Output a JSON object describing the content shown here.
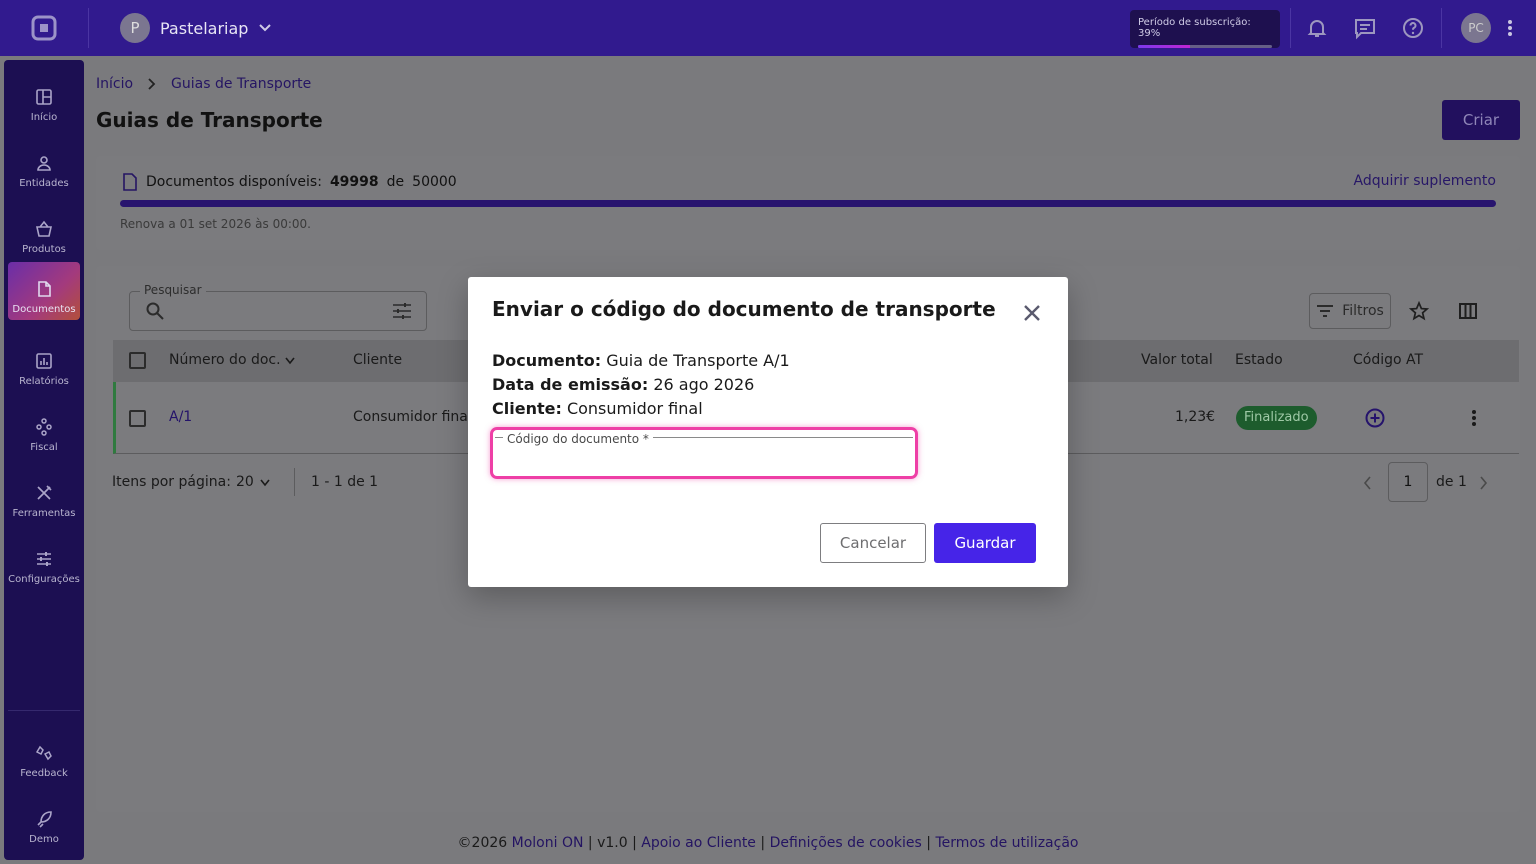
{
  "app": {
    "company_name": "Pastelariap",
    "company_initial": "P",
    "user_initials": "PC"
  },
  "subscription": {
    "label": "Período de subscrição: 39%",
    "progress": 0.39
  },
  "sidebar": {
    "items": [
      {
        "label": "Início",
        "icon": "dashboard-icon"
      },
      {
        "label": "Entidades",
        "icon": "person-icon"
      },
      {
        "label": "Produtos",
        "icon": "basket-icon"
      },
      {
        "label": "Documentos",
        "icon": "document-icon",
        "active": true
      },
      {
        "label": "Relatórios",
        "icon": "chart-icon"
      },
      {
        "label": "Fiscal",
        "icon": "hierarchy-icon"
      },
      {
        "label": "Ferramentas",
        "icon": "tools-icon"
      },
      {
        "label": "Configurações",
        "icon": "sliders-icon"
      }
    ],
    "bottom": [
      {
        "label": "Feedback",
        "icon": "feedback-icon"
      },
      {
        "label": "Demo",
        "icon": "rocket-icon"
      }
    ]
  },
  "breadcrumb": {
    "home": "Início",
    "current": "Guias de Transporte"
  },
  "page": {
    "title": "Guias de Transporte",
    "create_label": "Criar"
  },
  "quota": {
    "label": "Documentos disponíveis:",
    "available": "49998",
    "separator": "de",
    "total": "50000",
    "link": "Adquirir suplemento",
    "renew": "Renova a 01 set 2026 às 00:00."
  },
  "table": {
    "search_label": "Pesquisar",
    "filters_label": "Filtros",
    "columns": [
      "Número do doc.",
      "Cliente",
      "Valor total",
      "Estado",
      "Código AT"
    ],
    "rows": [
      {
        "number": "A/1",
        "client": "Consumidor final",
        "total": "1,23€",
        "status": "Finalizado"
      }
    ],
    "items_per_page_label": "Itens por página:",
    "items_per_page": "20",
    "range": "1 - 1 de 1",
    "page": "1",
    "of_pages": "de 1"
  },
  "modal": {
    "title": "Enviar o código do documento de transporte",
    "doc_label": "Documento:",
    "doc_value": "Guia de Transporte A/1",
    "date_label": "Data de emissão:",
    "date_value": "26 ago 2026",
    "client_label": "Cliente:",
    "client_value": "Consumidor final",
    "field_label": "Código do documento *",
    "field_value": "",
    "cancel_label": "Cancelar",
    "save_label": "Guardar"
  },
  "footer": {
    "copyright": "©2026",
    "brand": "Moloni ON",
    "version": "v1.0",
    "support": "Apoio ao Cliente",
    "cookies": "Definições de cookies",
    "terms": "Termos de utilização"
  },
  "colors": {
    "brand": "#3b23b0",
    "primary_button": "#4624e8",
    "focus": "#ee3fa6",
    "status_finalized": "#1f8a3a"
  }
}
